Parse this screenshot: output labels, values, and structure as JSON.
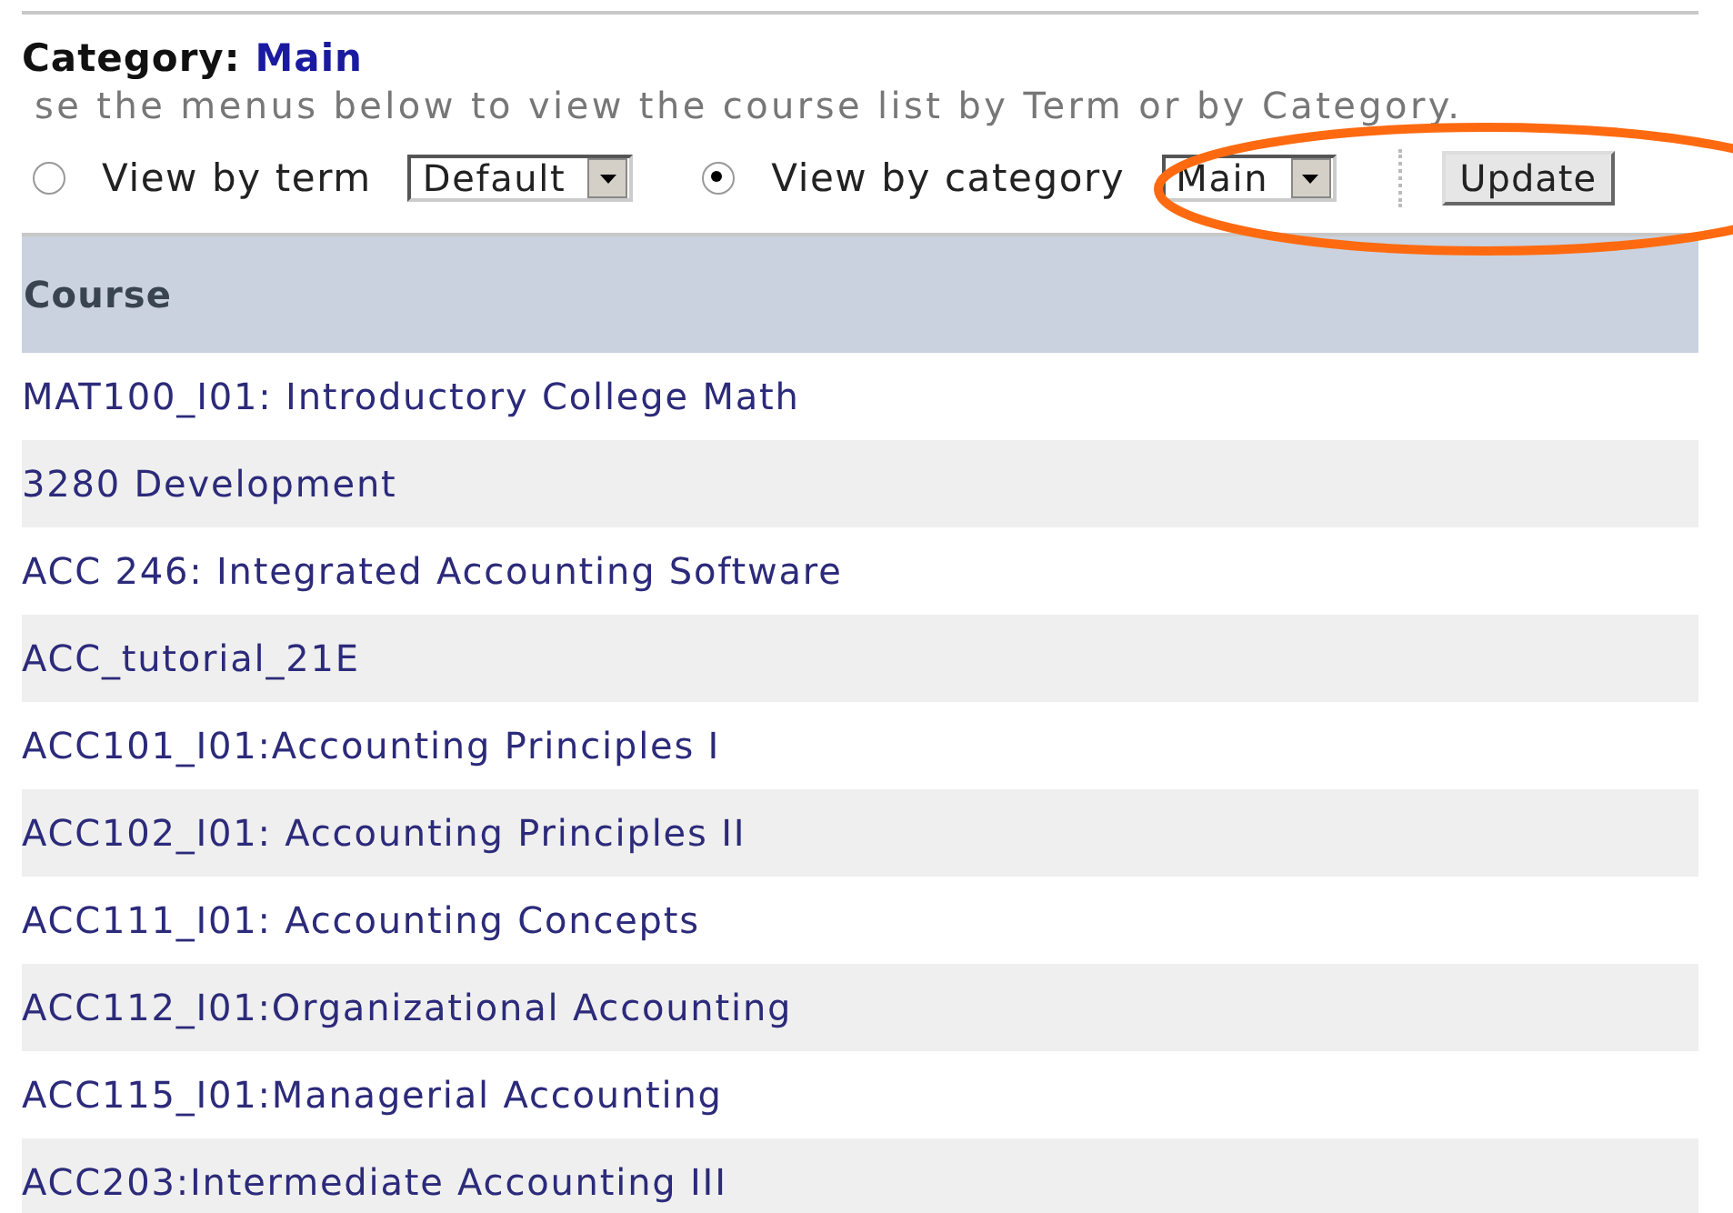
{
  "heading": {
    "label": "Category:",
    "value": "Main"
  },
  "instructions": "se the menus below to view the course list by Term or by Category.",
  "view_options": [
    {
      "label": "View by term",
      "selected": false,
      "dropdown": "Default"
    },
    {
      "label": "View by category",
      "selected": true,
      "dropdown": "Main"
    }
  ],
  "update_button": "Update",
  "table": {
    "columns": [
      "Course"
    ],
    "rows": [
      "MAT100_I01: Introductory College Math",
      "3280 Development",
      "ACC 246: Integrated Accounting Software",
      "ACC_tutorial_21E",
      "ACC101_I01:Accounting Principles I",
      "ACC102_I01: Accounting Principles II",
      "ACC111_I01: Accounting Concepts",
      "ACC112_I01:Organizational Accounting",
      "ACC115_I01:Managerial Accounting",
      "ACC203:Intermediate Accounting III"
    ]
  }
}
